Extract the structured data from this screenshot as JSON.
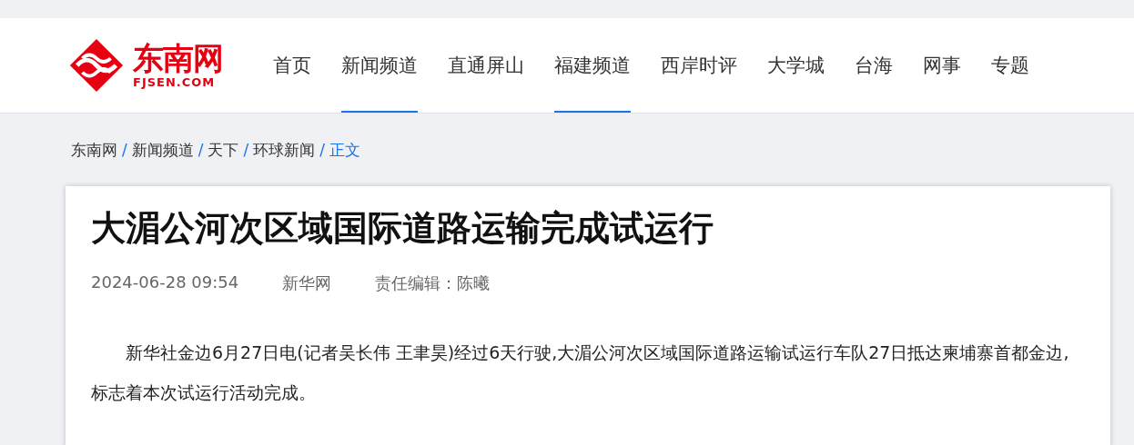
{
  "logo": {
    "name": "东南网",
    "domain": "FJSEN.COM"
  },
  "nav": [
    {
      "label": "首页",
      "selected": false
    },
    {
      "label": "新闻频道",
      "selected": true
    },
    {
      "label": "直通屏山",
      "selected": false
    },
    {
      "label": "福建频道",
      "selected": true
    },
    {
      "label": "西岸时评",
      "selected": false
    },
    {
      "label": "大学城",
      "selected": false
    },
    {
      "label": "台海",
      "selected": false
    },
    {
      "label": "网事",
      "selected": false
    },
    {
      "label": "专题",
      "selected": false
    }
  ],
  "breadcrumb_separator": "/",
  "breadcrumb": [
    {
      "label": "东南网",
      "current": false
    },
    {
      "label": "新闻频道",
      "current": false
    },
    {
      "label": "天下",
      "current": false
    },
    {
      "label": "环球新闻",
      "current": false
    },
    {
      "label": "正文",
      "current": true
    }
  ],
  "article": {
    "title": "大湄公河次区域国际道路运输完成试运行",
    "date": "2024-06-28 09:54",
    "source": "新华网",
    "editor": "责任编辑：陈曦",
    "paragraphs": [
      "新华社金边6月27日电(记者吴长伟 王聿昊)经过6天行驶,大湄公河次区域国际道路运输试运行车队27日抵达柬埔寨首都金边,标志着本次试运行活动完成。"
    ]
  }
}
